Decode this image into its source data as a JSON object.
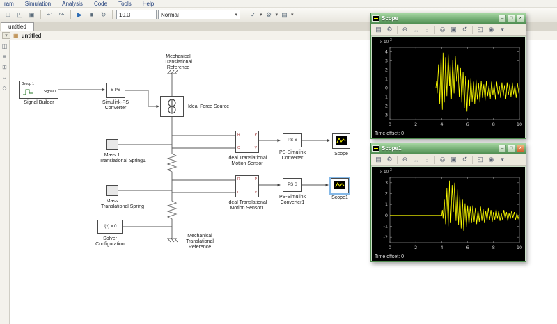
{
  "menu": {
    "items": [
      "ram",
      "Simulation",
      "Analysis",
      "Code",
      "Tools",
      "Help"
    ]
  },
  "toolbar": {
    "sim_stop_time": "10.0",
    "sim_mode": "Normal"
  },
  "tabs": {
    "model_tab": "untitled"
  },
  "navbar": {
    "breadcrumb": "untitled"
  },
  "icon_glyphs": {
    "new": "□",
    "open": "◰",
    "save": "▣",
    "undo": "↶",
    "redo": "↷",
    "run": "▶",
    "stop": "■",
    "refresh": "↻",
    "check": "✓",
    "gear": "⚙",
    "layers": "▤",
    "caret": "▾",
    "print": "▤",
    "parameters": "⚙",
    "zoom": "⊕",
    "zoom_x": "↔",
    "zoom_y": "↕",
    "autoscale": "◎",
    "save_axes": "▣",
    "restore": "↺",
    "float_scope": "◱",
    "lock": "◉",
    "library": "◫",
    "browser": "≡",
    "grid": "⊞",
    "fit": "↔",
    "annotate": "◇",
    "model": "▦"
  },
  "canvas": {
    "blocks": {
      "signal_builder": {
        "label": "Signal Builder",
        "group": "Group 1",
        "signal": "Signal 1"
      },
      "simulink_ps_converter": {
        "inner": "S PS",
        "label_lines": [
          "Simulink-PS",
          "Converter"
        ]
      },
      "mech_ref_top": {
        "label_lines": [
          "Mechanical",
          "Translational",
          "Reference"
        ]
      },
      "ideal_force_source": {
        "label": "Ideal Force Source"
      },
      "mass1": {
        "label": "Mass 1"
      },
      "spring1": {
        "label": "Translational Spring1"
      },
      "mass": {
        "label": "Mass"
      },
      "spring": {
        "label": "Translational Spring"
      },
      "solver_config": {
        "inner": "f(x) = 0",
        "label_lines": [
          "Solver",
          "Configuration"
        ]
      },
      "motion_sensor": {
        "label_lines": [
          "Ideal Translational",
          "Motion Sensor"
        ],
        "ports": {
          "r": "R",
          "c": "C",
          "p": "P",
          "v": "V"
        }
      },
      "ps_simulink_converter": {
        "inner": "PS S",
        "label_lines": [
          "PS-Simulink",
          "Converter"
        ]
      },
      "scope_block": {
        "label": "Scope"
      },
      "motion_sensor1": {
        "label_lines": [
          "Ideal Translational",
          "Motion Sensor1"
        ],
        "ports": {
          "r": "R",
          "c": "C",
          "p": "P",
          "v": "V"
        }
      },
      "ps_simulink_converter1": {
        "inner": "PS S",
        "label_lines": [
          "PS-Simulink",
          "Converter1"
        ]
      },
      "scope1_block": {
        "label": "Scope1"
      },
      "mech_ref_bottom": {
        "label_lines": [
          "Mechanical",
          "Translational",
          "Reference"
        ]
      }
    }
  },
  "scope_windows": [
    {
      "title": "Scope",
      "exp_base": "x 10",
      "exp_power": "-3",
      "time_offset_label": "Time offset:",
      "time_offset_value": "0"
    },
    {
      "title": "Scope1",
      "exp_base": "x 10",
      "exp_power": "-3",
      "time_offset_label": "Time offset:",
      "time_offset_value": "0"
    }
  ],
  "chart_data": [
    {
      "type": "line",
      "title": "Scope",
      "xlabel": "",
      "ylabel": "",
      "xlim": [
        0,
        10
      ],
      "ylim": [
        -3.5,
        4.5
      ],
      "xticks": [
        0,
        2,
        4,
        6,
        8,
        10
      ],
      "yticks": [
        4,
        3,
        2,
        1,
        0,
        -1,
        -2,
        -3
      ],
      "y_scale_label": "x 10^-3",
      "bg": "#000000",
      "grid": false,
      "series": [
        {
          "name": "signal",
          "color": "#ffff00",
          "points": [
            [
              0,
              0
            ],
            [
              3.55,
              0
            ],
            [
              3.6,
              0.8
            ],
            [
              3.65,
              -0.6
            ],
            [
              3.75,
              2.6
            ],
            [
              3.85,
              -1.8
            ],
            [
              3.95,
              3.6
            ],
            [
              4.05,
              -2.4
            ],
            [
              4.1,
              3.9
            ],
            [
              4.2,
              -1.6
            ],
            [
              4.3,
              3.4
            ],
            [
              4.4,
              -0.9
            ],
            [
              4.5,
              3.7
            ],
            [
              4.6,
              0.2
            ],
            [
              4.65,
              2.9
            ],
            [
              4.75,
              -1.2
            ],
            [
              4.85,
              3.1
            ],
            [
              4.95,
              -0.6
            ],
            [
              5.05,
              3.5
            ],
            [
              5.15,
              0.7
            ],
            [
              5.25,
              2.6
            ],
            [
              5.35,
              -1.0
            ],
            [
              5.45,
              2.2
            ],
            [
              5.55,
              -1.6
            ],
            [
              5.65,
              1.8
            ],
            [
              5.75,
              -2.2
            ],
            [
              5.85,
              1.3
            ],
            [
              5.95,
              -2.6
            ],
            [
              6.05,
              0.9
            ],
            [
              6.15,
              -2.0
            ],
            [
              6.25,
              1.1
            ],
            [
              6.35,
              -1.5
            ],
            [
              6.45,
              0.7
            ],
            [
              6.55,
              -1.8
            ],
            [
              6.65,
              0.9
            ],
            [
              6.75,
              -1.3
            ],
            [
              6.85,
              0.5
            ],
            [
              6.95,
              -1.6
            ],
            [
              7.05,
              0.8
            ],
            [
              7.15,
              -1.1
            ],
            [
              7.25,
              0.4
            ],
            [
              7.35,
              -1.4
            ],
            [
              7.45,
              0.8
            ],
            [
              7.55,
              -0.9
            ],
            [
              7.65,
              0.3
            ],
            [
              7.75,
              -1.2
            ],
            [
              7.85,
              0.7
            ],
            [
              7.95,
              -0.8
            ],
            [
              8.05,
              0.4
            ],
            [
              8.15,
              -1.3
            ],
            [
              8.25,
              0.7
            ],
            [
              8.35,
              -0.7
            ],
            [
              8.45,
              0.2
            ],
            [
              8.55,
              -1.1
            ],
            [
              8.65,
              0.6
            ],
            [
              8.75,
              -0.9
            ],
            [
              8.85,
              0.3
            ],
            [
              8.95,
              -1.2
            ],
            [
              9.05,
              0.6
            ],
            [
              9.15,
              -0.8
            ],
            [
              9.25,
              0.4
            ],
            [
              9.35,
              -1.0
            ],
            [
              9.45,
              0.6
            ],
            [
              9.55,
              -0.7
            ],
            [
              9.65,
              0.3
            ],
            [
              9.75,
              -1.1
            ],
            [
              9.85,
              0.5
            ],
            [
              9.95,
              -0.6
            ],
            [
              10,
              0
            ]
          ]
        }
      ]
    },
    {
      "type": "line",
      "title": "Scope1",
      "xlabel": "",
      "ylabel": "",
      "xlim": [
        0,
        10
      ],
      "ylim": [
        -2.5,
        3.5
      ],
      "xticks": [
        0,
        2,
        4,
        6,
        8,
        10
      ],
      "yticks": [
        3,
        2,
        1,
        0,
        -1,
        -2
      ],
      "y_scale_label": "x 10^-3",
      "bg": "#000000",
      "grid": false,
      "series": [
        {
          "name": "signal",
          "color": "#ffff00",
          "points": [
            [
              0,
              0
            ],
            [
              4.0,
              0
            ],
            [
              4.05,
              0.5
            ],
            [
              4.1,
              -0.3
            ],
            [
              4.2,
              1.5
            ],
            [
              4.3,
              -0.8
            ],
            [
              4.4,
              2.5
            ],
            [
              4.5,
              -1.0
            ],
            [
              4.6,
              3.2
            ],
            [
              4.7,
              -0.7
            ],
            [
              4.8,
              2.8
            ],
            [
              4.9,
              0.3
            ],
            [
              5.0,
              3.0
            ],
            [
              5.1,
              -0.5
            ],
            [
              5.2,
              2.4
            ],
            [
              5.3,
              -0.9
            ],
            [
              5.4,
              1.9
            ],
            [
              5.5,
              -1.2
            ],
            [
              5.6,
              1.5
            ],
            [
              5.7,
              -1.4
            ],
            [
              5.8,
              1.1
            ],
            [
              5.9,
              -1.1
            ],
            [
              6.0,
              0.9
            ],
            [
              6.1,
              -0.9
            ],
            [
              6.2,
              0.8
            ],
            [
              6.3,
              -0.7
            ],
            [
              6.4,
              0.9
            ],
            [
              6.5,
              -0.6
            ],
            [
              6.6,
              0.7
            ],
            [
              6.7,
              -0.8
            ],
            [
              6.8,
              0.5
            ],
            [
              6.9,
              -0.6
            ],
            [
              7.0,
              0.8
            ],
            [
              7.1,
              -0.5
            ],
            [
              7.2,
              0.6
            ],
            [
              7.3,
              -0.7
            ],
            [
              7.4,
              0.4
            ],
            [
              7.5,
              -0.5
            ],
            [
              7.6,
              0.7
            ],
            [
              7.7,
              -0.4
            ],
            [
              7.8,
              0.5
            ],
            [
              7.9,
              -0.6
            ],
            [
              8.0,
              0.3
            ],
            [
              8.1,
              -0.4
            ],
            [
              8.2,
              0.6
            ],
            [
              8.3,
              -0.3
            ],
            [
              8.4,
              0.4
            ],
            [
              8.5,
              -0.5
            ],
            [
              8.6,
              0.2
            ],
            [
              8.7,
              -0.4
            ],
            [
              8.8,
              0.5
            ],
            [
              8.9,
              -0.3
            ],
            [
              9.0,
              0.3
            ],
            [
              9.1,
              -0.5
            ],
            [
              9.2,
              0.2
            ],
            [
              9.3,
              -0.3
            ],
            [
              9.4,
              0.4
            ],
            [
              9.5,
              -0.2
            ],
            [
              9.6,
              0.3
            ],
            [
              9.7,
              -0.4
            ],
            [
              9.8,
              0.2
            ],
            [
              9.9,
              -0.3
            ],
            [
              10,
              0.1
            ]
          ]
        }
      ]
    }
  ]
}
